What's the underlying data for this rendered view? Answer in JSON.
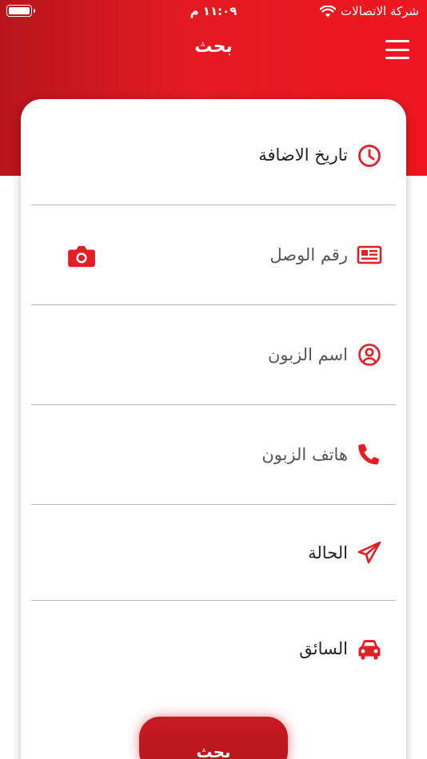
{
  "status_bar": {
    "carrier": "شركة الاتصالات",
    "time": "١١:٠٩ م"
  },
  "header": {
    "title": "بحث",
    "menu_icon": "hamburger-menu-icon"
  },
  "form": {
    "rows": [
      {
        "icon": "clock-icon",
        "label": "تاريخ الاضافة",
        "is_placeholder": false
      },
      {
        "icon": "newspaper-icon",
        "label": "رقم الوصل",
        "is_placeholder": true,
        "action_icon": "camera-icon"
      },
      {
        "icon": "user-circle-icon",
        "label": "اسم الزبون",
        "is_placeholder": true
      },
      {
        "icon": "phone-icon",
        "label": "هاتف الزبون",
        "is_placeholder": true
      },
      {
        "icon": "paper-plane-icon",
        "label": "الحالة",
        "is_placeholder": false
      },
      {
        "icon": "car-icon",
        "label": "السائق",
        "is_placeholder": false
      }
    ]
  },
  "search_button": {
    "label": "بحث"
  },
  "colors": {
    "brand_red": "#e41b23",
    "icon_red": "#e51d25",
    "divider": "#b9b9b9"
  }
}
